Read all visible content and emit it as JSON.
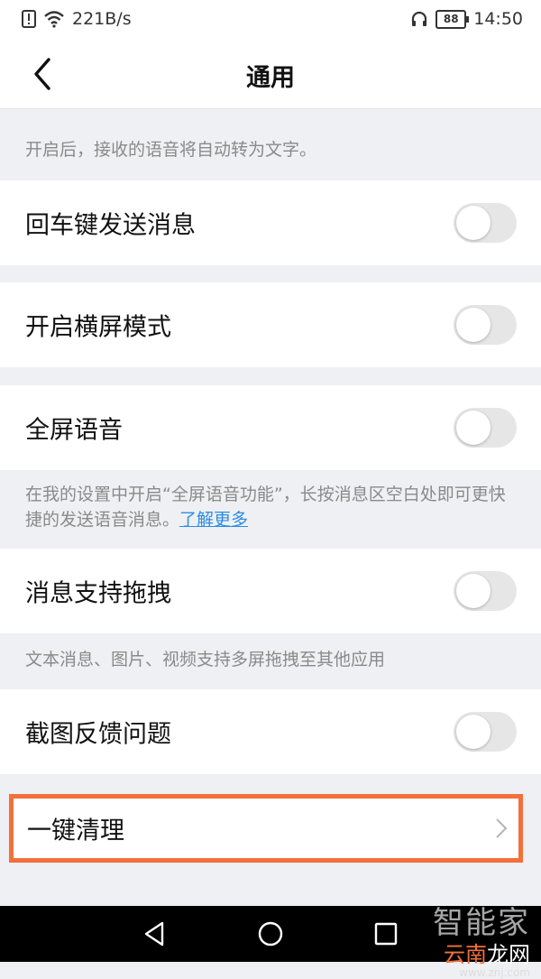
{
  "status_bar": {
    "speed": "221B/s",
    "battery": "88",
    "time": "14:50"
  },
  "nav": {
    "title": "通用"
  },
  "notes": {
    "voice_to_text": "开启后，接收的语音将自动转为文字。",
    "fullscreen_voice_text": "在我的设置中开启“全屏语音功能”，长按消息区空白处即可更快捷的发送语音消息。",
    "fullscreen_voice_link": "了解更多",
    "drag_support": "文本消息、图片、视频支持多屏拖拽至其他应用"
  },
  "settings": [
    {
      "label": "回车键发送消息",
      "enabled": false
    },
    {
      "label": "开启横屏模式",
      "enabled": false
    },
    {
      "label": "全屏语音",
      "enabled": false
    },
    {
      "label": "消息支持拖拽",
      "enabled": false
    },
    {
      "label": "截图反馈问题",
      "enabled": false
    }
  ],
  "cleanup": {
    "label": "一键清理"
  },
  "watermark": {
    "top": "智能家",
    "bottom_accent": "云南",
    "bottom_rest": "龙网",
    "small": "www.znj.com"
  },
  "colors": {
    "highlight_border": "#f2703b",
    "link": "#2e8ce3",
    "toggle_off": "#e6e6e6",
    "background": "#eef0f3"
  }
}
